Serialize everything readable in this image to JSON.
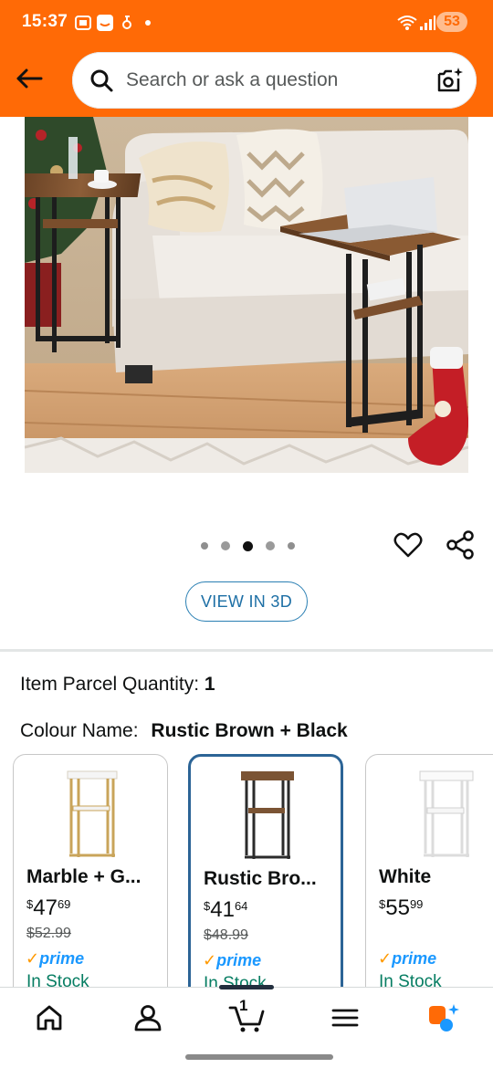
{
  "status_bar": {
    "time": "15:37",
    "battery": "53"
  },
  "search": {
    "placeholder": "Search or ask a question"
  },
  "product_image": {
    "description_icon": "living-room-c-table-photo"
  },
  "carousel": {
    "count": 5,
    "active_index": 2
  },
  "view_3d": {
    "label": "VIEW IN 3D"
  },
  "specs": {
    "parcel_label": "Item Parcel Quantity:",
    "parcel_value": "1",
    "colour_label": "Colour Name:",
    "colour_value": "Rustic Brown + Black"
  },
  "variants": [
    {
      "name": "Marble + G...",
      "price_whole": "47",
      "price_cents": "69",
      "was": "$52.99",
      "prime": "prime",
      "stock": "In Stock",
      "selected": false
    },
    {
      "name": "Rustic Bro...",
      "price_whole": "41",
      "price_cents": "64",
      "was": "$48.99",
      "prime": "prime",
      "stock": "In Stock",
      "selected": true
    },
    {
      "name": "White",
      "price_whole": "55",
      "price_cents": "99",
      "was": "",
      "prime": "prime",
      "stock": "In Stock",
      "selected": false
    }
  ],
  "currency_symbol": "$",
  "bottom_nav": {
    "cart_count": "1"
  },
  "colors": {
    "header": "#ff6a06",
    "selected_border": "#2c6496",
    "link": "#1d6fa5",
    "stock": "#067d62",
    "prime": "#1a98ff"
  }
}
